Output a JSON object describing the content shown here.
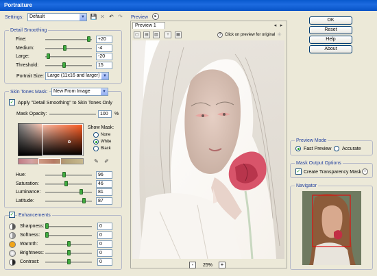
{
  "window": {
    "title": "Portraiture"
  },
  "settings": {
    "label": "Settings:",
    "value": "Default"
  },
  "detail_smoothing": {
    "title": "Detail Smoothing",
    "rows": [
      {
        "label": "Fine:",
        "value": "+20",
        "pos": 0.97
      },
      {
        "label": "Medium:",
        "value": "-4",
        "pos": 0.42
      },
      {
        "label": "Large:",
        "value": "-20",
        "pos": 0.03
      },
      {
        "label": "Threshold:",
        "value": "15",
        "pos": 0.4
      }
    ],
    "portrait_size_label": "Portrait Size:",
    "portrait_size_value": "Large (11x16 and larger)"
  },
  "skin_tones": {
    "title": "Skin Tones Mask:",
    "mode_value": "New From Image",
    "apply_label": "Apply \"Detail Smoothing\" to Skin Tones Only",
    "mask_opacity_label": "Mask Opacity:",
    "mask_opacity_value": "100",
    "percent": "%",
    "show_mask_label": "Show Mask:",
    "show_mask_options": [
      "None",
      "White",
      "Black"
    ],
    "sliders": [
      {
        "label": "Hue:",
        "value": "96",
        "pos": 0.4
      },
      {
        "label": "Saturation:",
        "value": "46",
        "pos": 0.45
      },
      {
        "label": "Luminance:",
        "value": "81",
        "pos": 0.8
      },
      {
        "label": "Latitude:",
        "value": "87",
        "pos": 0.86
      }
    ]
  },
  "enhancements": {
    "title": "Enhancements",
    "rows": [
      {
        "label": "Sharpness:",
        "value": "0",
        "pos": 0.0
      },
      {
        "label": "Softness:",
        "value": "0",
        "pos": 0.0
      },
      {
        "label": "Warmth:",
        "value": "0",
        "pos": 0.5
      },
      {
        "label": "Brightness:",
        "value": "0",
        "pos": 0.5
      },
      {
        "label": "Contrast:",
        "value": "0",
        "pos": 0.5
      }
    ]
  },
  "preview": {
    "label": "Preview",
    "tab": "Preview 1",
    "hint": "Click on preview for original",
    "zoom": "25%",
    "minus": "-",
    "plus": "+"
  },
  "buttons": {
    "ok": "OK",
    "reset": "Reset",
    "help": "Help",
    "about": "About"
  },
  "preview_mode": {
    "title": "Preview Mode",
    "fast": "Fast Preview",
    "accurate": "Accurate"
  },
  "mask_output": {
    "title": "Mask Output Options",
    "create": "Create Transparency Mask"
  },
  "navigator": {
    "title": "Navigator"
  },
  "colors": {
    "panel": "#ECE9D8",
    "title_blue": "#1F3E9E",
    "slider_thumb": "#3FAA3F",
    "titlebar": "#0A5ACE"
  }
}
